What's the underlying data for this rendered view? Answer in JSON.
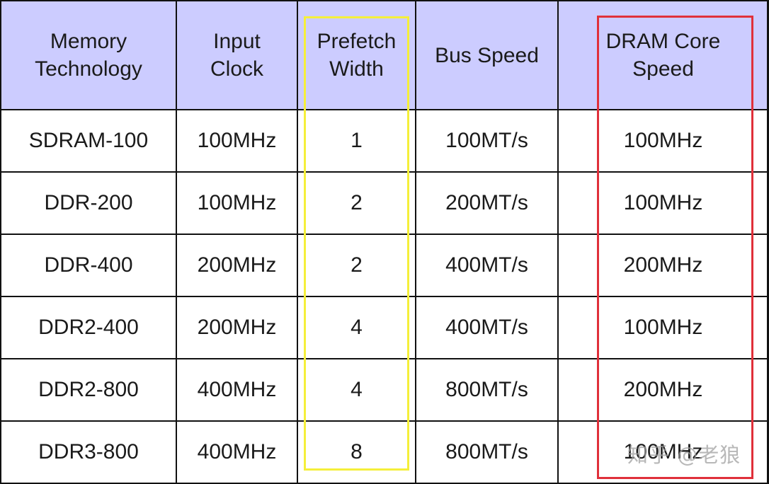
{
  "table": {
    "headers": [
      "Memory Technology",
      "Input Clock",
      "Prefetch Width",
      "Bus Speed",
      "DRAM Core Speed"
    ],
    "header_lines": [
      [
        "Memory",
        "Technology"
      ],
      [
        "Input",
        "Clock"
      ],
      [
        "Prefetch",
        "Width"
      ],
      [
        "Bus Speed"
      ],
      [
        "DRAM Core",
        "Speed"
      ]
    ],
    "rows": [
      [
        "SDRAM-100",
        "100MHz",
        "1",
        "100MT/s",
        "100MHz"
      ],
      [
        "DDR-200",
        "100MHz",
        "2",
        "200MT/s",
        "100MHz"
      ],
      [
        "DDR-400",
        "200MHz",
        "2",
        "400MT/s",
        "200MHz"
      ],
      [
        "DDR2-400",
        "200MHz",
        "4",
        "400MT/s",
        "100MHz"
      ],
      [
        "DDR2-800",
        "400MHz",
        "4",
        "800MT/s",
        "200MHz"
      ],
      [
        "DDR3-800",
        "400MHz",
        "8",
        "800MT/s",
        "100MHz"
      ]
    ]
  },
  "highlights": {
    "yellow_column": "Prefetch Width",
    "red_column": "DRAM Core Speed",
    "yellow_color": "#f5ef3a",
    "red_color": "#e0303a"
  },
  "header_bg": "#ccccff",
  "watermark": "知乎 @老狼"
}
